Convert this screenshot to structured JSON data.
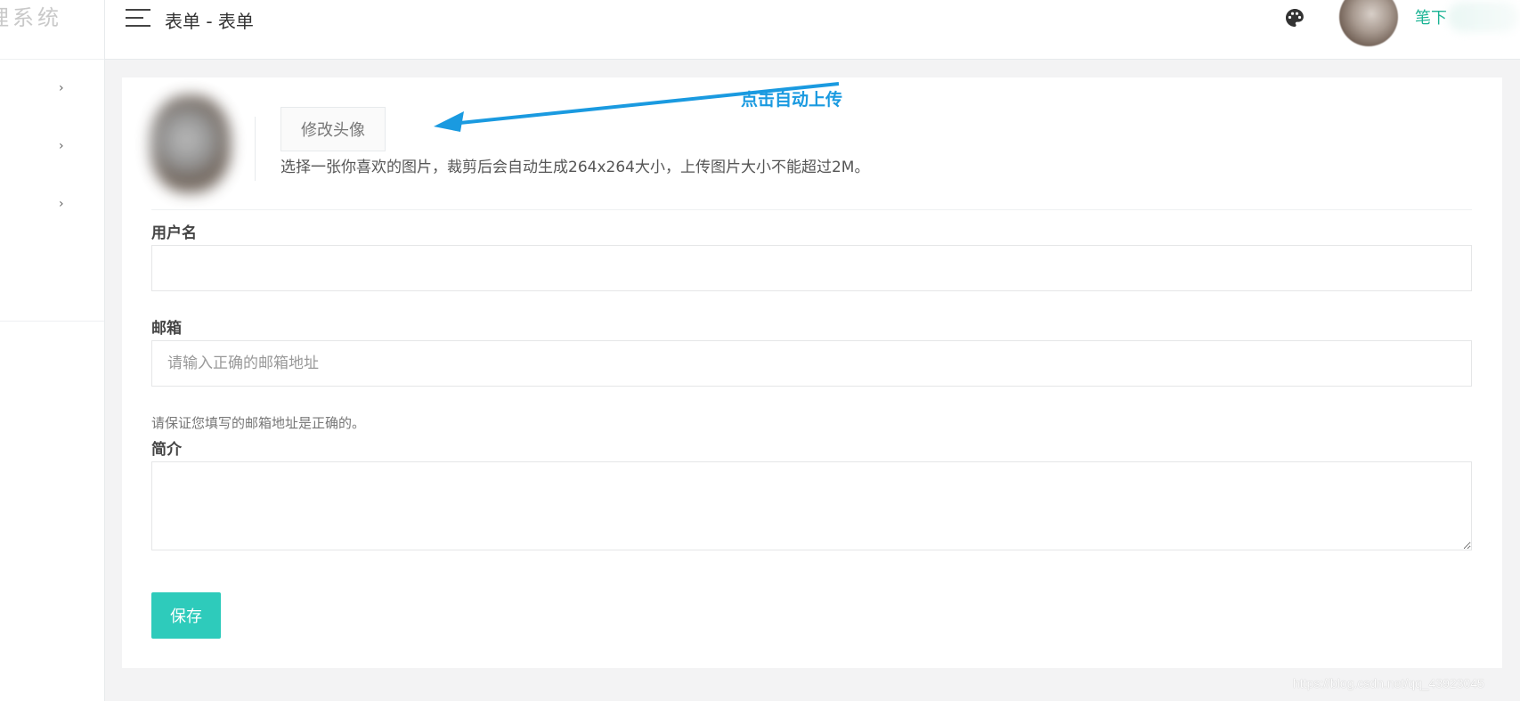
{
  "sidebar": {
    "brand": "理系统",
    "items": [
      {
        "chevron": "›"
      },
      {
        "chevron": "›"
      },
      {
        "chevron": "›"
      }
    ]
  },
  "header": {
    "title": "表单 - 表单",
    "menu_icon": "hamburger-icon",
    "theme_icon": "palette-icon",
    "username": "笔下"
  },
  "avatar_section": {
    "change_button_label": "修改头像",
    "annotation": "点击自动上传",
    "hint": "选择一张你喜欢的图片，裁剪后会自动生成264x264大小，上传图片大小不能超过2M。"
  },
  "form": {
    "username": {
      "label": "用户名",
      "value": "",
      "placeholder": ""
    },
    "email": {
      "label": "邮箱",
      "value": "",
      "placeholder": "请输入正确的邮箱地址",
      "help": "请保证您填写的邮箱地址是正确的。"
    },
    "bio": {
      "label": "简介",
      "value": "",
      "placeholder": ""
    },
    "save_label": "保存"
  },
  "colors": {
    "accent": "#1ab394",
    "save_button": "#2ecbbb",
    "annotation": "#1a9ae0"
  },
  "watermark": "https://blog.csdn.net/qq_43923045"
}
